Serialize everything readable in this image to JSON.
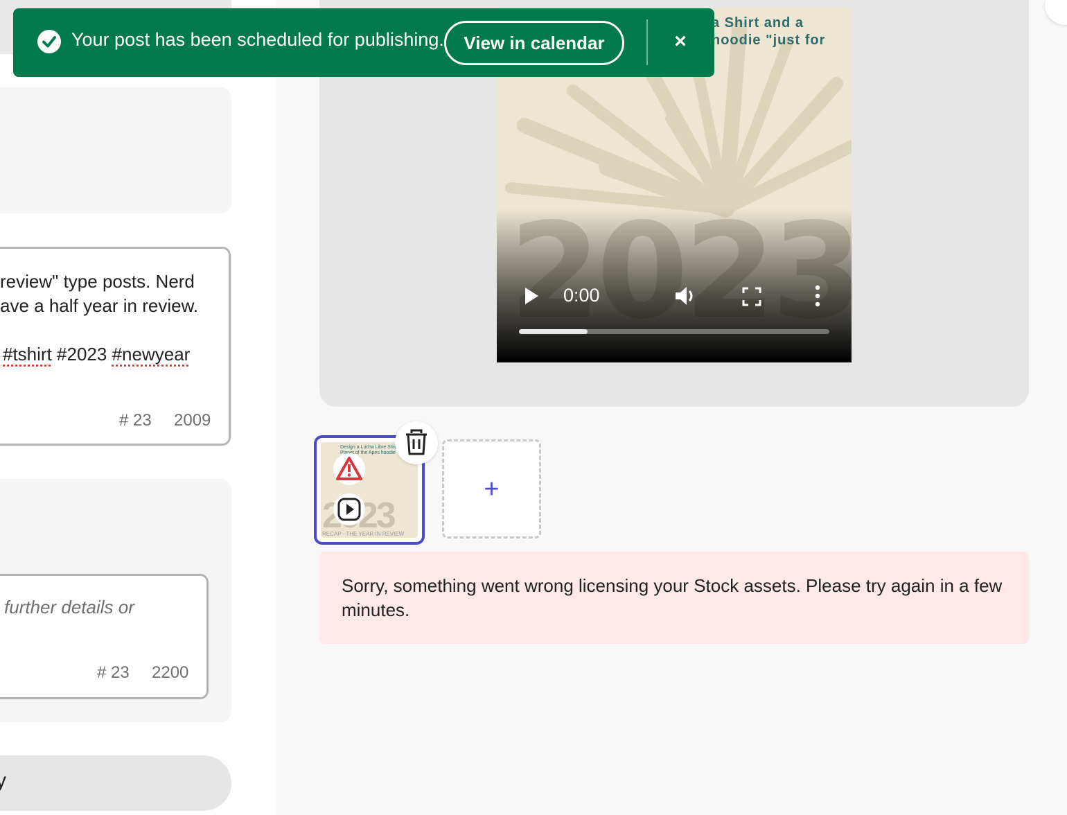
{
  "toast": {
    "message": "Your post has been scheduled for publishing.",
    "calendar_button": "View in calendar",
    "close_glyph": "×",
    "color": "#007a4d"
  },
  "caption_card_1": {
    "line1": "review\" type posts. Nerd",
    "line2": "ave a half year in review.",
    "hashtags": [
      "#tshirt",
      "#2023",
      "#newyear"
    ],
    "hashtag_count": "# 23",
    "char_count": "2009"
  },
  "caption_card_2": {
    "placeholder": "further details or",
    "hashtag_count": "# 23",
    "char_count": "2200"
  },
  "left_button": {
    "label": "y"
  },
  "video": {
    "overlay_line1": "a Shirt and a",
    "overlay_line2": "hoodie \"just for",
    "year_art": "2023",
    "time": "0:00",
    "progress": 0.22
  },
  "thumbnail": {
    "title_line1": "Design a Lucha Libre Shirt",
    "title_line2": "Planet of the Apes hoodie",
    "year_art": "2023",
    "caption": "RECAP - THE YEAR IN REVIEW"
  },
  "add_tile": {
    "glyph": "+"
  },
  "error": {
    "message": "Sorry, something went wrong licensing your Stock assets. Please try again in a few minutes."
  },
  "icons": {
    "check": "check-circle-icon",
    "close": "close-icon",
    "play": "play-icon",
    "volume": "volume-icon",
    "fullscreen": "fullscreen-icon",
    "more": "more-vertical-icon",
    "trash": "trash-icon",
    "alert": "alert-triangle-icon",
    "video": "video-play-icon"
  },
  "colors": {
    "accent": "#4b4bc4",
    "alert": "#d7373f",
    "error_bg": "#ffe8e8"
  }
}
